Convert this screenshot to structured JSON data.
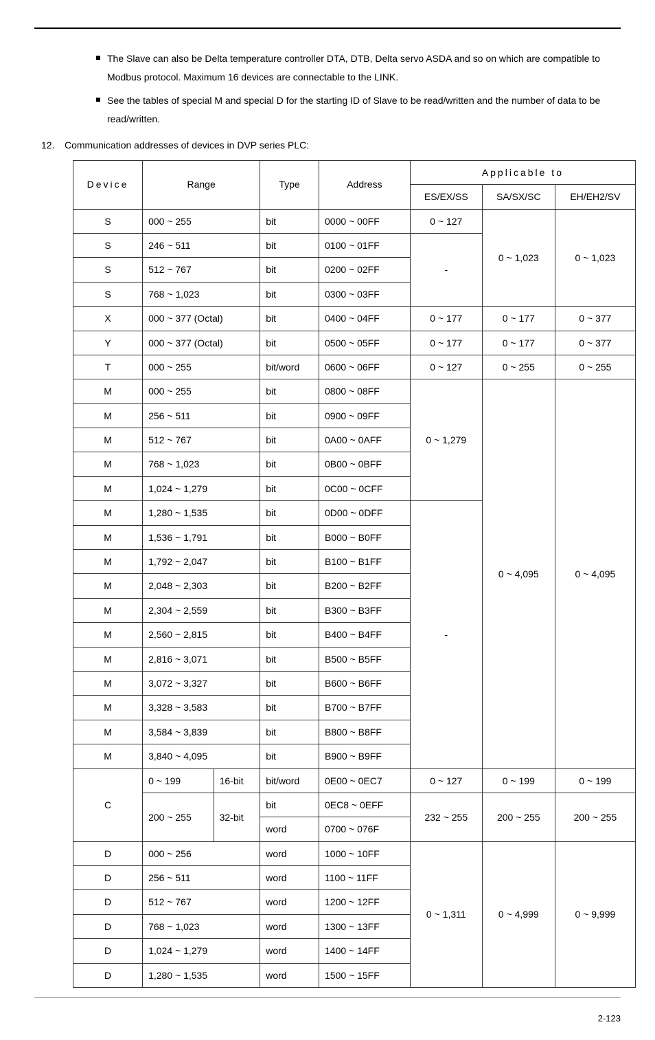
{
  "bullets": [
    "The Slave can also be Delta temperature controller DTA, DTB, Delta servo ASDA and so on which are compatible to Modbus protocol. Maximum 16 devices are connectable to the LINK.",
    "See the tables of special M and special D for the starting ID of Slave to be read/written and the number of data to be read/written."
  ],
  "item_num": "12.",
  "item_text": "Communication addresses of devices in DVP series PLC:",
  "headers": {
    "device": "Device",
    "range": "Range",
    "type": "Type",
    "address": "Address",
    "applicable": "Applicable to",
    "es": "ES/EX/SS",
    "sa": "SA/SX/SC",
    "eh": "EH/EH2/SV"
  },
  "rows": {
    "r1": {
      "dev": "S",
      "range": "000 ~ 255",
      "type": "bit",
      "addr": "0000 ~ 00FF",
      "es": "0 ~ 127"
    },
    "r2": {
      "dev": "S",
      "range": "246 ~ 511",
      "type": "bit",
      "addr": "0100 ~ 01FF"
    },
    "r3": {
      "dev": "S",
      "range": "512 ~ 767",
      "type": "bit",
      "addr": "0200 ~ 02FF"
    },
    "r4": {
      "dev": "S",
      "range": "768 ~ 1,023",
      "type": "bit",
      "addr": "0300 ~ 03FF"
    },
    "r5": {
      "dev": "X",
      "range": "000 ~ 377 (Octal)",
      "type": "bit",
      "addr": "0400 ~ 04FF",
      "es": "0 ~ 177",
      "sa": "0 ~ 177",
      "eh": "0 ~ 377"
    },
    "r6": {
      "dev": "Y",
      "range": "000 ~ 377 (Octal)",
      "type": "bit",
      "addr": "0500 ~ 05FF",
      "es": "0 ~ 177",
      "sa": "0 ~ 177",
      "eh": "0 ~ 377"
    },
    "r7": {
      "dev": "T",
      "range": "000 ~ 255",
      "type": "bit/word",
      "addr": "0600 ~ 06FF",
      "es": "0 ~ 127",
      "sa": "0 ~ 255",
      "eh": "0 ~ 255"
    },
    "r8": {
      "dev": "M",
      "range": "000 ~ 255",
      "type": "bit",
      "addr": "0800 ~ 08FF"
    },
    "r9": {
      "dev": "M",
      "range": "256 ~ 511",
      "type": "bit",
      "addr": "0900 ~ 09FF"
    },
    "r10": {
      "dev": "M",
      "range": "512 ~ 767",
      "type": "bit",
      "addr": "0A00 ~ 0AFF"
    },
    "r11": {
      "dev": "M",
      "range": "768 ~ 1,023",
      "type": "bit",
      "addr": "0B00 ~ 0BFF"
    },
    "r12": {
      "dev": "M",
      "range": "1,024 ~ 1,279",
      "type": "bit",
      "addr": "0C00 ~ 0CFF"
    },
    "r13": {
      "dev": "M",
      "range": "1,280 ~ 1,535",
      "type": "bit",
      "addr": "0D00 ~ 0DFF"
    },
    "r14": {
      "dev": "M",
      "range": "1,536 ~ 1,791",
      "type": "bit",
      "addr": "B000 ~ B0FF"
    },
    "r15": {
      "dev": "M",
      "range": "1,792 ~ 2,047",
      "type": "bit",
      "addr": "B100 ~ B1FF"
    },
    "r16": {
      "dev": "M",
      "range": "2,048 ~ 2,303",
      "type": "bit",
      "addr": "B200 ~ B2FF"
    },
    "r17": {
      "dev": "M",
      "range": "2,304 ~ 2,559",
      "type": "bit",
      "addr": "B300 ~ B3FF"
    },
    "r18": {
      "dev": "M",
      "range": "2,560 ~ 2,815",
      "type": "bit",
      "addr": "B400 ~ B4FF"
    },
    "r19": {
      "dev": "M",
      "range": "2,816 ~ 3,071",
      "type": "bit",
      "addr": "B500 ~ B5FF"
    },
    "r20": {
      "dev": "M",
      "range": "3,072 ~ 3,327",
      "type": "bit",
      "addr": "B600 ~ B6FF"
    },
    "r21": {
      "dev": "M",
      "range": "3,328 ~ 3,583",
      "type": "bit",
      "addr": "B700 ~ B7FF"
    },
    "r22": {
      "dev": "M",
      "range": "3,584 ~ 3,839",
      "type": "bit",
      "addr": "B800 ~ B8FF"
    },
    "r23": {
      "dev": "M",
      "range": "3,840 ~ 4,095",
      "type": "bit",
      "addr": "B900 ~ B9FF"
    },
    "m_es": "0 ~ 1,279",
    "m_dash": "-",
    "m_sa": "0 ~ 4,095",
    "m_eh": "0 ~ 4,095",
    "s_dash": "-",
    "s_sa": "0 ~ 1,023",
    "s_eh": "0 ~ 1,023",
    "c1": {
      "range": "0 ~ 199",
      "bits": "16-bit",
      "type": "bit/word",
      "addr": "0E00 ~ 0EC7",
      "es": "0 ~ 127",
      "sa": "0 ~ 199",
      "eh": "0 ~ 199"
    },
    "c2": {
      "range": "200 ~ 255",
      "bits": "32-bit",
      "type1": "bit",
      "addr1": "0EC8 ~ 0EFF",
      "type2": "word",
      "addr2": "0700 ~ 076F",
      "es": "232 ~ 255",
      "sa": "200 ~ 255",
      "eh": "200 ~ 255"
    },
    "c_dev": "C",
    "d1": {
      "dev": "D",
      "range": "000 ~ 256",
      "type": "word",
      "addr": "1000 ~ 10FF"
    },
    "d2": {
      "dev": "D",
      "range": "256 ~ 511",
      "type": "word",
      "addr": "1100 ~ 11FF"
    },
    "d3": {
      "dev": "D",
      "range": "512 ~ 767",
      "type": "word",
      "addr": "1200 ~ 12FF"
    },
    "d4": {
      "dev": "D",
      "range": "768 ~ 1,023",
      "type": "word",
      "addr": "1300 ~ 13FF"
    },
    "d5": {
      "dev": "D",
      "range": "1,024 ~ 1,279",
      "type": "word",
      "addr": "1400 ~ 14FF"
    },
    "d6": {
      "dev": "D",
      "range": "1,280 ~ 1,535",
      "type": "word",
      "addr": "1500 ~ 15FF"
    },
    "d_es": "0 ~ 1,311",
    "d_sa": "0 ~ 4,999",
    "d_eh": "0 ~ 9,999"
  },
  "page": "2-123"
}
